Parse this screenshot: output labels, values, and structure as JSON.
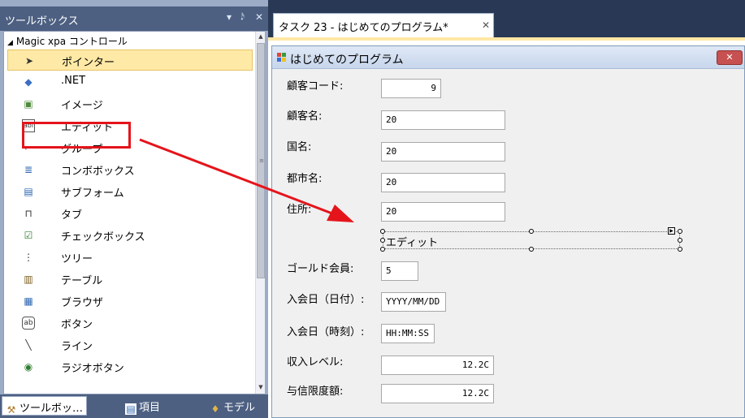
{
  "toolbox": {
    "title": "ツールボックス",
    "controls": {
      "dropdown": "▾",
      "pin": "ᵖ",
      "close": "✕"
    },
    "group_label": "Magic xpa コントロール",
    "items": [
      {
        "label": "ポインター",
        "icon": "pointer-icon",
        "glyph": "➤",
        "selected": true
      },
      {
        "label": ".NET",
        "icon": "dotnet-icon",
        "glyph": "◆"
      },
      {
        "label": "イメージ",
        "icon": "image-icon",
        "glyph": "▣"
      },
      {
        "label": "エディット",
        "icon": "edit-icon",
        "glyph": "abl"
      },
      {
        "label": "グループ",
        "icon": "group-icon",
        "glyph": "⌐"
      },
      {
        "label": "コンボボックス",
        "icon": "combobox-icon",
        "glyph": "≣"
      },
      {
        "label": "サブフォーム",
        "icon": "subform-icon",
        "glyph": "▤"
      },
      {
        "label": "タブ",
        "icon": "tab-icon",
        "glyph": "⊓"
      },
      {
        "label": "チェックボックス",
        "icon": "checkbox-icon",
        "glyph": "☑"
      },
      {
        "label": "ツリー",
        "icon": "tree-icon",
        "glyph": "⋮"
      },
      {
        "label": "テーブル",
        "icon": "table-icon",
        "glyph": "▥"
      },
      {
        "label": "ブラウザ",
        "icon": "browser-icon",
        "glyph": "▦"
      },
      {
        "label": "ボタン",
        "icon": "button-icon",
        "glyph": "ab"
      },
      {
        "label": "ライン",
        "icon": "line-icon",
        "glyph": "╲"
      },
      {
        "label": "ラジオボタン",
        "icon": "radio-button-icon",
        "glyph": "◉"
      }
    ],
    "bottom_tabs": [
      {
        "label": "ツールボッ…",
        "icon": "toolbox-tab-icon",
        "glyph": "⚒",
        "active": true
      },
      {
        "label": "項目",
        "icon": "fields-tab-icon",
        "glyph": "▤"
      },
      {
        "label": "モデル",
        "icon": "models-tab-icon",
        "glyph": "♦"
      }
    ]
  },
  "document": {
    "tab_title": "タスク 23 - はじめてのプログラム*",
    "tab_close": "✕",
    "form": {
      "title": "はじめてのプログラム",
      "close_glyph": "✕",
      "fields": [
        {
          "label": "顧客コード:",
          "value": "9",
          "align": "right"
        },
        {
          "label": "顧客名:",
          "value": "20"
        },
        {
          "label": "国名:",
          "value": "20"
        },
        {
          "label": "都市名:",
          "value": "20"
        },
        {
          "label": "住所:",
          "value": "20"
        },
        {
          "label": "ゴールド会員:",
          "value": "5"
        },
        {
          "label": "入会日（日付）:",
          "value": "YYYY/MM/DD"
        },
        {
          "label": "入会日（時刻）:",
          "value": "HH:MM:SS"
        },
        {
          "label": "収入レベル:",
          "value": "12.2C",
          "align": "right"
        },
        {
          "label": "与信限度額:",
          "value": "12.2C",
          "align": "right"
        }
      ],
      "new_edit_control": {
        "label": "エディット",
        "marker": "▶"
      }
    }
  },
  "annotation": {
    "highlight_color": "#e5141b",
    "arrow_color": "#e5141b"
  },
  "colors": {
    "ide_background": "#293955",
    "toolbox_header": "#4d6082",
    "selected_item": "#fee9a6",
    "form_background": "#f0f0f0"
  }
}
